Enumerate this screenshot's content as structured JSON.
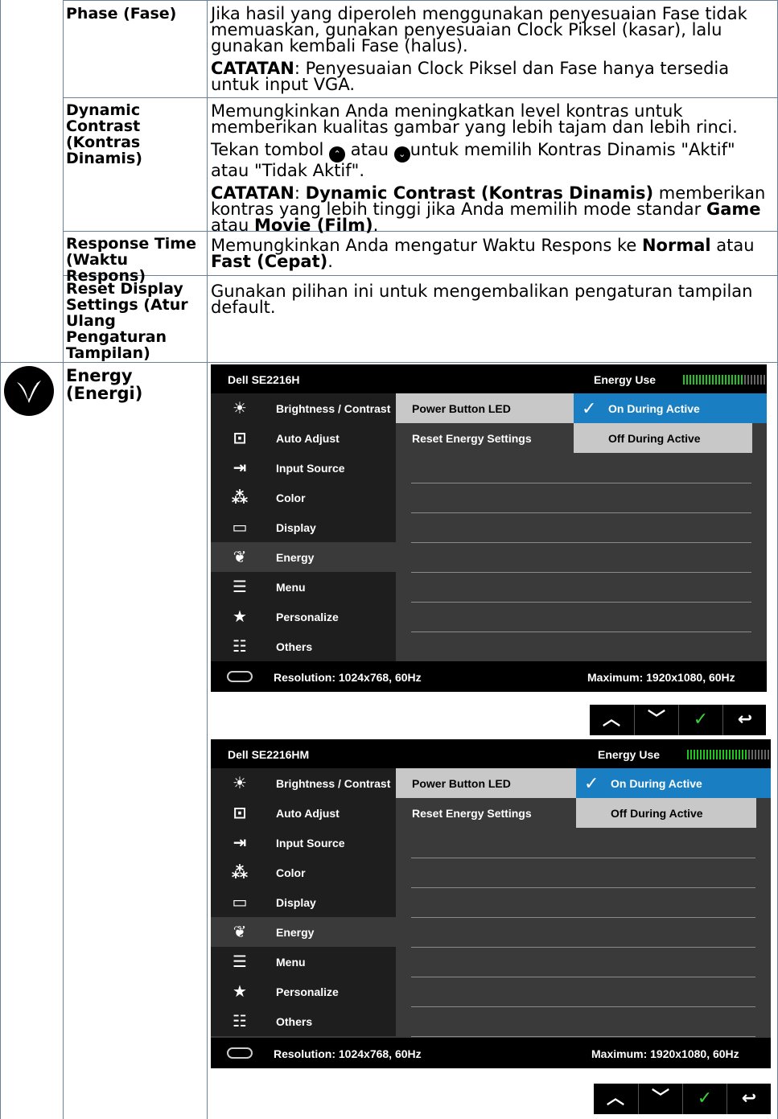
{
  "rows": [
    {
      "name": "Phase (Fase)",
      "desc": [
        {
          "text": "Jika hasil yang diperoleh menggunakan penyesuaian Fase tidak memuaskan, gunakan penyesuaian Clock Piksel (kasar), lalu gunakan kembali Fase (halus)."
        },
        {
          "note_label": "CATATAN",
          "note_text": ": Penyesuaian Clock Piksel dan Fase hanya tersedia untuk input VGA."
        }
      ]
    },
    {
      "name": "Dynamic Contrast (Kontras Dinamis)",
      "p1": "Memungkinkan Anda meningkatkan level kontras untuk memberikan kualitas gambar yang lebih tajam dan lebih rinci.",
      "p2a": "Tekan tombol ",
      "p2b": " atau ",
      "p2c": "untuk memilih Kontras Dinamis \"Aktif\" atau \"Tidak Aktif\".",
      "p3_label": "CATATAN",
      "p3_a": ": ",
      "p3_b": "Dynamic Contrast (Kontras Dinamis)",
      "p3_c": " memberikan kontras yang lebih tinggi jika Anda memilih mode standar ",
      "p3_d": "Game",
      "p3_e": " atau ",
      "p3_f": "Movie (Film)",
      "p3_g": "."
    },
    {
      "name": "Response Time (Waktu Respons)",
      "a": "Memungkinkan Anda mengatur Waktu Respons ke ",
      "b": "Normal",
      "c": " atau ",
      "d": "Fast (Cepat)",
      "e": "."
    },
    {
      "name": "Reset Display Settings (Atur Ulang Pengaturan Tampilan)",
      "text": "Gunakan pilihan ini untuk mengembalikan pengaturan tampilan default."
    },
    {
      "name": "Energy (Energi)"
    }
  ],
  "osd": [
    {
      "model": "Dell SE2216H",
      "energy_label": "Energy Use",
      "energy_level": 0.72,
      "menu": [
        "Brightness / Contrast",
        "Auto Adjust",
        "Input Source",
        "Color",
        "Display",
        "Energy",
        "Menu",
        "Personalize",
        "Others"
      ],
      "menu_icons": [
        "brightness-icon",
        "auto-adjust-icon",
        "input-source-icon",
        "color-icon",
        "display-icon",
        "energy-icon",
        "menu-icon",
        "personalize-icon",
        "others-icon"
      ],
      "selected": "Energy",
      "sub": [
        "Power Button LED",
        "Reset Energy Settings"
      ],
      "options": [
        "On During Active",
        "Off During Active"
      ],
      "resolution": "Resolution: 1024x768, 60Hz",
      "maximum": "Maximum: 1920x1080, 60Hz"
    },
    {
      "model": "Dell  SE2216HM",
      "energy_label": "Energy Use",
      "energy_level": 0.72,
      "menu": [
        "Brightness / Contrast",
        "Auto Adjust",
        "Input Source",
        "Color",
        "Display",
        "Energy",
        "Menu",
        "Personalize",
        "Others"
      ],
      "menu_icons": [
        "brightness-icon",
        "auto-adjust-icon",
        "input-source-icon",
        "color-icon",
        "display-icon",
        "energy-icon",
        "menu-icon",
        "personalize-icon",
        "others-icon"
      ],
      "selected": "Energy",
      "sub": [
        "Power Button LED",
        "Reset Energy Settings"
      ],
      "options": [
        "On During Active",
        "Off During Active"
      ],
      "resolution": "Resolution: 1024x768, 60Hz",
      "maximum": "Maximum: 1920x1080, 60Hz"
    }
  ],
  "button_bar": [
    "up-icon",
    "down-icon",
    "check-icon",
    "back-icon"
  ]
}
